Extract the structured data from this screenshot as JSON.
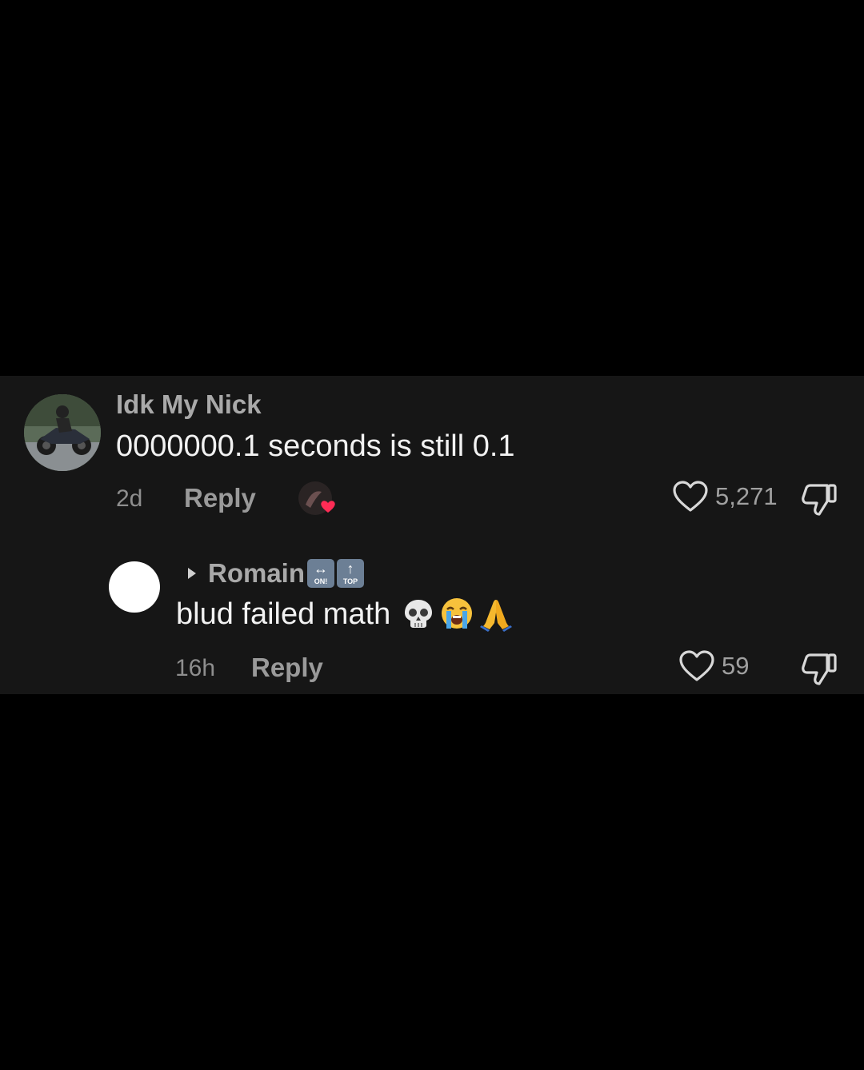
{
  "comment": {
    "username": "Idk My Nick",
    "text": "0000000.1 seconds is still 0.1",
    "time": "2d",
    "reply_label": "Reply",
    "likes": "5,271",
    "creator_liked": true
  },
  "reply": {
    "replying_to": "Romain",
    "badges": [
      {
        "icon": "on-arrow-key",
        "caption": "ON!"
      },
      {
        "icon": "top-arrow-key",
        "caption": "TOP"
      }
    ],
    "text": "blud failed math",
    "emojis": [
      "skull",
      "loudly-crying-face",
      "folded-hands"
    ],
    "time": "16h",
    "reply_label": "Reply",
    "likes": "59"
  },
  "colors": {
    "background": "#000000",
    "panel": "#161616",
    "primary_text": "#f2f2f2",
    "secondary_text": "#a9a9a9",
    "heart_badge": "#fe2c55"
  }
}
